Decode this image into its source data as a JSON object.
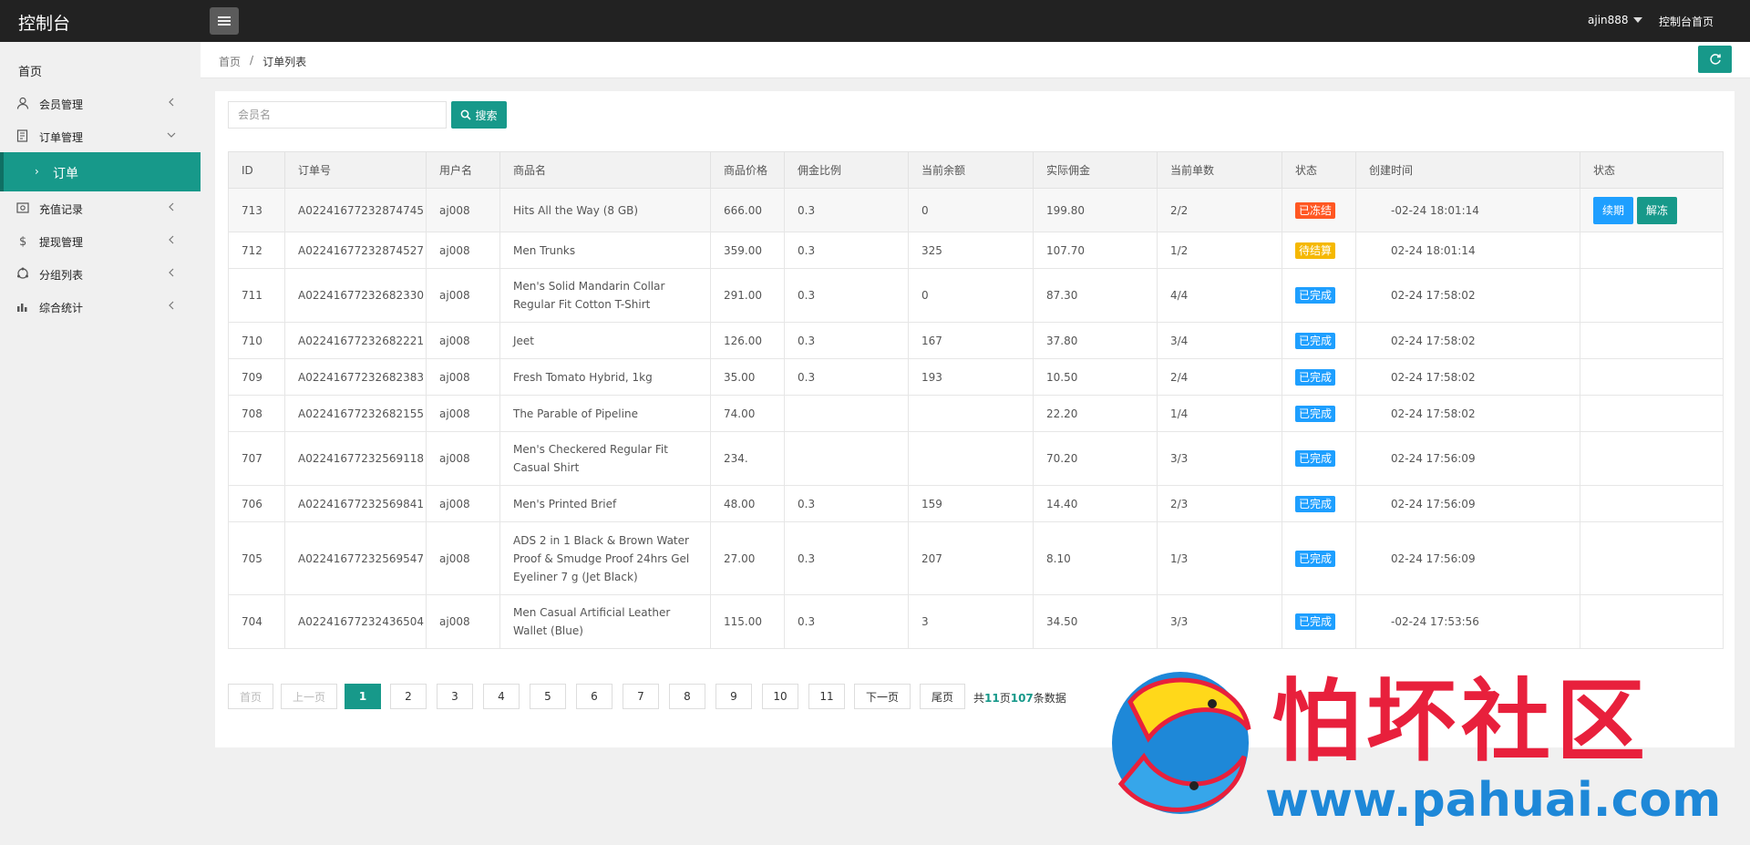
{
  "topbar": {
    "brand": "控制台",
    "user": "ajin888",
    "home_link": "控制台首页"
  },
  "sidebar": {
    "home": "首页",
    "items": [
      {
        "label": "会员管理",
        "icon": "user-icon"
      },
      {
        "label": "订单管理",
        "icon": "order-icon",
        "expanded": true
      },
      {
        "label": "充值记录",
        "icon": "recharge-icon"
      },
      {
        "label": "提现管理",
        "icon": "dollar-icon"
      },
      {
        "label": "分组列表",
        "icon": "group-icon"
      },
      {
        "label": "综合统计",
        "icon": "chart-icon"
      }
    ],
    "active_sub": "订单"
  },
  "breadcrumb": {
    "home": "首页",
    "sep": "/",
    "current": "订单列表"
  },
  "search": {
    "placeholder": "会员名",
    "button": "搜索"
  },
  "table": {
    "headers": [
      "ID",
      "订单号",
      "用户名",
      "商品名",
      "商品价格",
      "佣金比例",
      "当前余额",
      "实际佣金",
      "当前单数",
      "状态",
      "创建时间",
      "状态"
    ],
    "rows": [
      {
        "id": "713",
        "order_no": "A02241677232874745",
        "user": "aj008",
        "product": "Hits All the Way (8 GB)",
        "price": "666.00",
        "ratio": "0.3",
        "balance": "0",
        "commission": "199.80",
        "count": "2/2",
        "status": "已冻结",
        "status_type": "frozen",
        "time": "-02-24 18:01:14",
        "actions": [
          "续期",
          "解冻"
        ]
      },
      {
        "id": "712",
        "order_no": "A02241677232874527",
        "user": "aj008",
        "product": "Men Trunks",
        "price": "359.00",
        "ratio": "0.3",
        "balance": "325",
        "commission": "107.70",
        "count": "1/2",
        "status": "待结算",
        "status_type": "pending",
        "time": "02-24 18:01:14"
      },
      {
        "id": "711",
        "order_no": "A02241677232682330",
        "user": "aj008",
        "product": "Men's Solid Mandarin Collar Regular Fit Cotton T-Shirt",
        "price": "291.00",
        "ratio": "0.3",
        "balance": "0",
        "commission": "87.30",
        "count": "4/4",
        "status": "已完成",
        "status_type": "done",
        "time": "02-24 17:58:02"
      },
      {
        "id": "710",
        "order_no": "A02241677232682221",
        "user": "aj008",
        "product": "Jeet",
        "price": "126.00",
        "ratio": "0.3",
        "balance": "167",
        "commission": "37.80",
        "count": "3/4",
        "status": "已完成",
        "status_type": "done",
        "time": "02-24 17:58:02"
      },
      {
        "id": "709",
        "order_no": "A02241677232682383",
        "user": "aj008",
        "product": "Fresh Tomato Hybrid, 1kg",
        "price": "35.00",
        "ratio": "0.3",
        "balance": "193",
        "commission": "10.50",
        "count": "2/4",
        "status": "已完成",
        "status_type": "done",
        "time": "02-24 17:58:02"
      },
      {
        "id": "708",
        "order_no": "A02241677232682155",
        "user": "aj008",
        "product": "The Parable of Pipeline",
        "price": "74.00",
        "ratio": "",
        "balance": "",
        "commission": "22.20",
        "count": "1/4",
        "status": "已完成",
        "status_type": "done",
        "time": "02-24 17:58:02"
      },
      {
        "id": "707",
        "order_no": "A02241677232569118",
        "user": "aj008",
        "product": "Men's Checkered Regular Fit Casual Shirt",
        "price": "234.",
        "ratio": "",
        "balance": "",
        "commission": "70.20",
        "count": "3/3",
        "status": "已完成",
        "status_type": "done",
        "time": "02-24 17:56:09"
      },
      {
        "id": "706",
        "order_no": "A02241677232569841",
        "user": "aj008",
        "product": "Men's Printed Brief",
        "price": "48.00",
        "ratio": "0.3",
        "balance": "159",
        "commission": "14.40",
        "count": "2/3",
        "status": "已完成",
        "status_type": "done",
        "time": "02-24 17:56:09"
      },
      {
        "id": "705",
        "order_no": "A02241677232569547",
        "user": "aj008",
        "product": "ADS 2 in 1 Black & Brown Water Proof & Smudge Proof 24hrs Gel Eyeliner 7 g (Jet Black)",
        "price": "27.00",
        "ratio": "0.3",
        "balance": "207",
        "commission": "8.10",
        "count": "1/3",
        "status": "已完成",
        "status_type": "done",
        "time": "02-24 17:56:09"
      },
      {
        "id": "704",
        "order_no": "A02241677232436504",
        "user": "aj008",
        "product": "Men Casual Artificial Leather Wallet (Blue)",
        "price": "115.00",
        "ratio": "0.3",
        "balance": "3",
        "commission": "34.50",
        "count": "3/3",
        "status": "已完成",
        "status_type": "done",
        "time": "-02-24 17:53:56"
      }
    ]
  },
  "pagination": {
    "first": "首页",
    "prev": "上一页",
    "pages": [
      "1",
      "2",
      "3",
      "4",
      "5",
      "6",
      "7",
      "8",
      "9",
      "10",
      "11"
    ],
    "current": "1",
    "next": "下一页",
    "last": "尾页",
    "info_prefix": "共",
    "total_pages": "11",
    "info_mid": "页",
    "total_records": "107",
    "info_suffix": "条数据"
  },
  "watermark": {
    "text": "怕坏社区",
    "url": "www.pahuai.com"
  },
  "colors": {
    "accent": "#17998a",
    "topbar": "#222222",
    "frozen": "#ff5722",
    "pending": "#f5b800",
    "done": "#1e9fff"
  }
}
